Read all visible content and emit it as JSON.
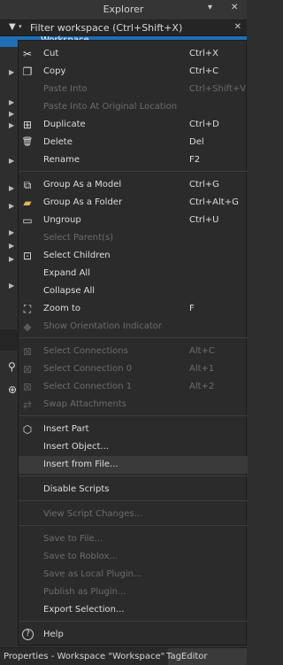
{
  "window": {
    "title": "Explorer",
    "controls": [
      "▾",
      "✕"
    ]
  },
  "filter": {
    "placeholder": "Filter workspace (Ctrl+Shift+X)"
  },
  "tree": {
    "selected_label": "Workspace"
  },
  "menu": {
    "items": [
      {
        "label": "Cut",
        "shortcut": "Ctrl+X",
        "icon": "scissors-icon",
        "glyph": "✂",
        "disabled": false
      },
      {
        "label": "Copy",
        "shortcut": "Ctrl+C",
        "icon": "copy-icon",
        "glyph": "❐",
        "disabled": false
      },
      {
        "label": "Paste Into",
        "shortcut": "Ctrl+Shift+V",
        "icon": "",
        "glyph": "",
        "disabled": true
      },
      {
        "label": "Paste Into At Original Location",
        "shortcut": "",
        "icon": "",
        "glyph": "",
        "disabled": true
      },
      {
        "label": "Duplicate",
        "shortcut": "Ctrl+D",
        "icon": "duplicate-icon",
        "glyph": "⊞",
        "disabled": false
      },
      {
        "label": "Delete",
        "shortcut": "Del",
        "icon": "trash-icon",
        "glyph": "🗑",
        "disabled": false
      },
      {
        "label": "Rename",
        "shortcut": "F2",
        "icon": "",
        "glyph": "",
        "disabled": false
      },
      {
        "label": "Group As a Model",
        "shortcut": "Ctrl+G",
        "icon": "group-model-icon",
        "glyph": "⧉",
        "disabled": false
      },
      {
        "label": "Group As a Folder",
        "shortcut": "Ctrl+Alt+G",
        "icon": "folder-icon",
        "glyph": "▰",
        "disabled": false
      },
      {
        "label": "Ungroup",
        "shortcut": "Ctrl+U",
        "icon": "ungroup-icon",
        "glyph": "▭",
        "disabled": false
      },
      {
        "label": "Select Parent(s)",
        "shortcut": "",
        "icon": "",
        "glyph": "",
        "disabled": true
      },
      {
        "label": "Select Children",
        "shortcut": "",
        "icon": "select-children-icon",
        "glyph": "⊡",
        "disabled": false
      },
      {
        "label": "Expand All",
        "shortcut": "",
        "icon": "",
        "glyph": "",
        "disabled": false
      },
      {
        "label": "Collapse All",
        "shortcut": "",
        "icon": "",
        "glyph": "",
        "disabled": false
      },
      {
        "label": "Zoom to",
        "shortcut": "F",
        "icon": "zoom-to-icon",
        "glyph": "⛶",
        "disabled": false
      },
      {
        "label": "Show Orientation Indicator",
        "shortcut": "",
        "icon": "orientation-icon",
        "glyph": "◆",
        "disabled": true
      },
      {
        "label": "Select Connections",
        "shortcut": "Alt+C",
        "icon": "select-connections-icon",
        "glyph": "⊠",
        "disabled": true
      },
      {
        "label": "Select Connection 0",
        "shortcut": "Alt+1",
        "icon": "select-connection-0-icon",
        "glyph": "⊠",
        "disabled": true
      },
      {
        "label": "Select Connection 1",
        "shortcut": "Alt+2",
        "icon": "select-connection-1-icon",
        "glyph": "⊠",
        "disabled": true
      },
      {
        "label": "Swap Attachments",
        "shortcut": "",
        "icon": "swap-icon",
        "glyph": "⇄",
        "disabled": true
      },
      {
        "label": "Insert Part",
        "shortcut": "",
        "icon": "part-icon",
        "glyph": "⬡",
        "disabled": false
      },
      {
        "label": "Insert Object...",
        "shortcut": "",
        "icon": "",
        "glyph": "",
        "disabled": false
      },
      {
        "label": "Insert from File...",
        "shortcut": "",
        "icon": "",
        "glyph": "",
        "disabled": false
      },
      {
        "label": "Disable Scripts",
        "shortcut": "",
        "icon": "",
        "glyph": "",
        "disabled": false
      },
      {
        "label": "View Script Changes...",
        "shortcut": "",
        "icon": "",
        "glyph": "",
        "disabled": true
      },
      {
        "label": "Save to File...",
        "shortcut": "",
        "icon": "",
        "glyph": "",
        "disabled": true
      },
      {
        "label": "Save to Roblox...",
        "shortcut": "",
        "icon": "",
        "glyph": "",
        "disabled": true
      },
      {
        "label": "Save as Local Plugin...",
        "shortcut": "",
        "icon": "",
        "glyph": "",
        "disabled": true
      },
      {
        "label": "Publish as Plugin...",
        "shortcut": "",
        "icon": "",
        "glyph": "",
        "disabled": true
      },
      {
        "label": "Export Selection...",
        "shortcut": "",
        "icon": "",
        "glyph": "",
        "disabled": false
      },
      {
        "label": "Help",
        "shortcut": "",
        "icon": "help-icon",
        "glyph": "?",
        "disabled": false
      }
    ]
  },
  "bottom_tabs": {
    "properties": "Properties - Workspace \"Workspace\"",
    "tageditor": "TagEditor"
  }
}
